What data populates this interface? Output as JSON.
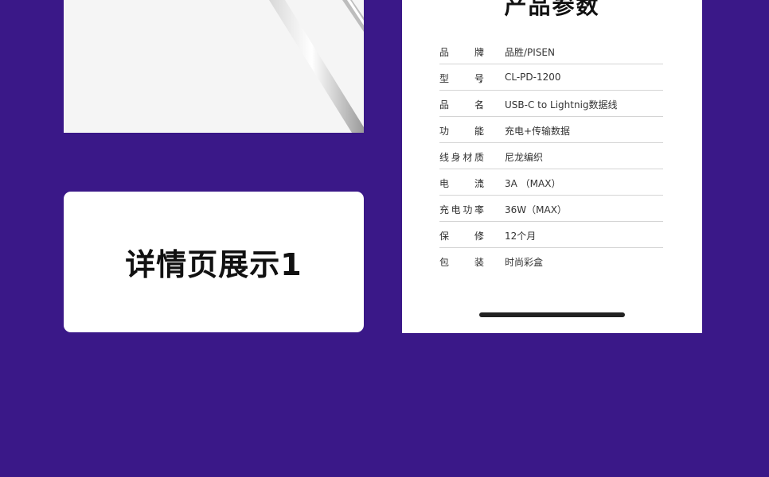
{
  "page": {
    "background_color": "#3a1888"
  },
  "product_image": {
    "icon": "cable-image",
    "background_color": "#f5f5f5"
  },
  "detail_card": {
    "title": "详情页展示1"
  },
  "spec_card": {
    "title": "产品参数",
    "colon": "：",
    "rows": [
      {
        "label": "品 牌",
        "value": "品胜/PISEN"
      },
      {
        "label": "型 号",
        "value": "CL-PD-1200"
      },
      {
        "label": "品 名",
        "value": "USB-C to Lightnig数据线"
      },
      {
        "label": "功 能",
        "value": "充电+传输数据"
      },
      {
        "label": "线身材质",
        "value": "尼龙编织"
      },
      {
        "label": "电 流",
        "value": "3A （MAX）"
      },
      {
        "label": "充电功率",
        "value": "36W（MAX）"
      },
      {
        "label": "保 修",
        "value": "12个月"
      },
      {
        "label": "包 装",
        "value": "时尚彩盒"
      }
    ]
  }
}
